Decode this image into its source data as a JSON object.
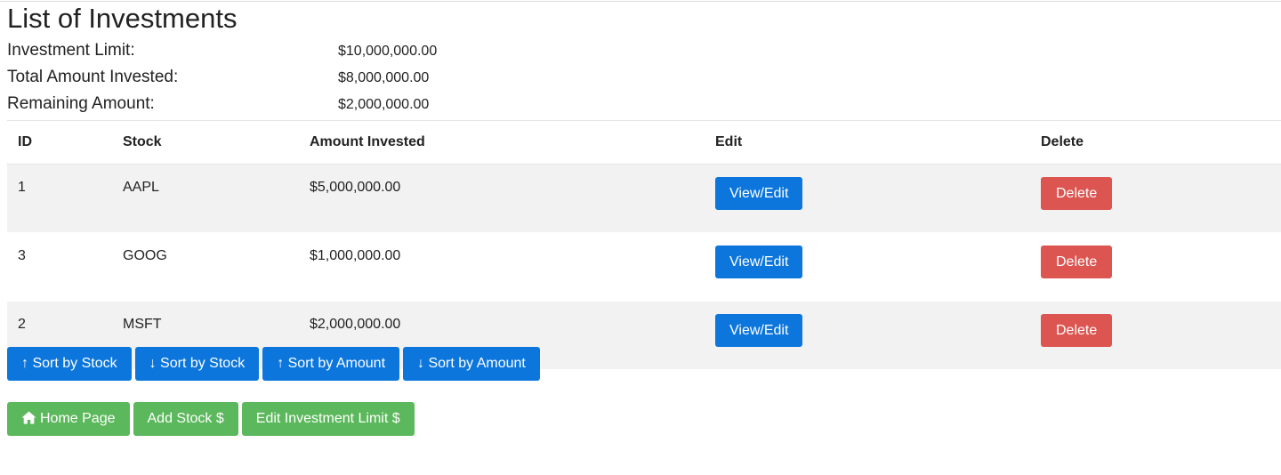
{
  "page": {
    "title": "List of Investments"
  },
  "summary": {
    "items": [
      {
        "label": "Investment Limit:",
        "value": "$10,000,000.00"
      },
      {
        "label": "Total Amount Invested:",
        "value": "$8,000,000.00"
      },
      {
        "label": "Remaining Amount:",
        "value": "$2,000,000.00"
      }
    ]
  },
  "table": {
    "headers": [
      "ID",
      "Stock",
      "Amount Invested",
      "Edit",
      "Delete"
    ],
    "rows": [
      {
        "id": "1",
        "stock": "AAPL",
        "amount": "$5,000,000.00",
        "edit_label": "View/Edit",
        "delete_label": "Delete"
      },
      {
        "id": "3",
        "stock": "GOOG",
        "amount": "$1,000,000.00",
        "edit_label": "View/Edit",
        "delete_label": "Delete"
      },
      {
        "id": "2",
        "stock": "MSFT",
        "amount": "$2,000,000.00",
        "edit_label": "View/Edit",
        "delete_label": "Delete"
      }
    ]
  },
  "sort": {
    "stock_asc": "↑ Sort by Stock",
    "stock_desc": "↓ Sort by Stock",
    "amount_asc": "↑ Sort by Amount",
    "amount_desc": "↓ Sort by Amount"
  },
  "nav": {
    "home_label": "Home Page",
    "home_icon": "home-icon",
    "add_stock_label": "Add Stock $",
    "edit_limit_label": "Edit Investment Limit $"
  },
  "colors": {
    "primary": "#0c76dc",
    "danger": "#dc5551",
    "success": "#5cb85c",
    "stripe": "#f2f2f2"
  }
}
